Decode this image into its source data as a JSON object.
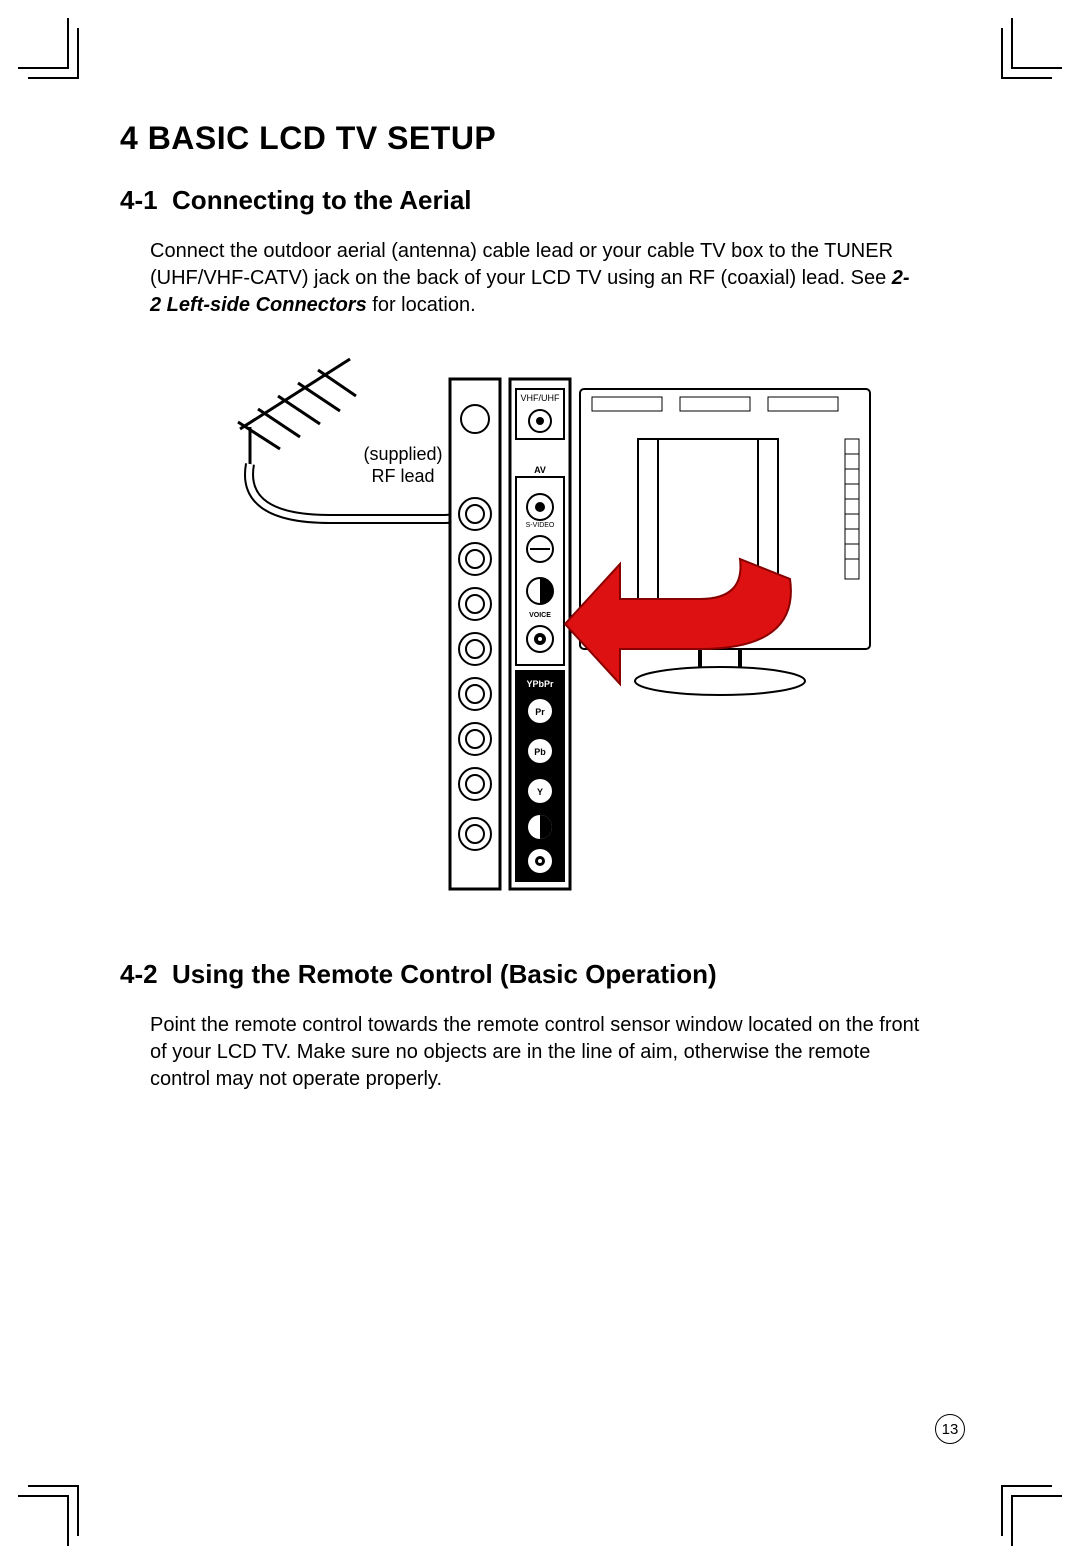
{
  "chapter": {
    "number": "4",
    "title": "BASIC LCD TV SETUP"
  },
  "sec1": {
    "heading_no": "4-1",
    "heading_txt": "Connecting to the Aerial",
    "para_pre": "Connect the outdoor aerial (antenna) cable lead or your cable TV box to the TUNER (UHF/VHF-CATV) jack on the back of your LCD TV using an RF (coaxial) lead. See ",
    "para_ref": "2-2 Left-side Connectors",
    "para_post": " for location."
  },
  "illus": {
    "supplied_line1": "(supplied)",
    "supplied_line2": "RF lead",
    "port_top": "VHF/UHF",
    "port_group_av": "AV",
    "port_svideo": "S-VIDEO",
    "port_video": "⊖",
    "port_audio_l": "◑",
    "port_voice_lbl": "VOICE",
    "port_audio_r": "◉",
    "port_ypbpr_lbl": "YPbPr",
    "port_pr": "Pr",
    "port_pb": "Pb",
    "port_y": "Y",
    "port_l": "◑",
    "port_r": "◉"
  },
  "sec2": {
    "heading_no": "4-2",
    "heading_txt": "Using the Remote Control (Basic Operation)",
    "para": "Point the remote control towards the remote control sensor window located on the front of your LCD TV. Make sure no objects are in the line of aim, otherwise the remote control may not operate properly."
  },
  "page_number": "13"
}
